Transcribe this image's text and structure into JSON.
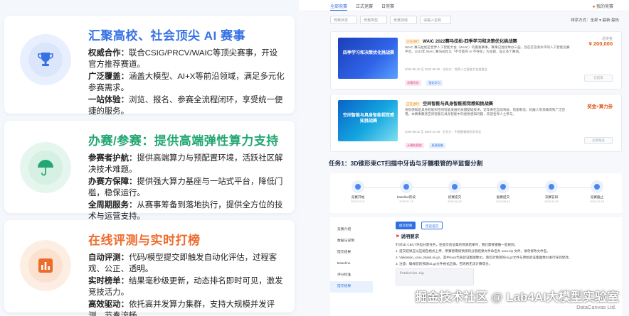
{
  "features": [
    {
      "title": "汇聚高校、社会顶尖 AI 赛事",
      "icon": "trophy-icon",
      "color": "#3672e6",
      "items": [
        {
          "label": "权威合作：",
          "text": "联合CSIG/PRCV/WAIC等顶尖赛事，开设官方推荐赛道。"
        },
        {
          "label": "广泛覆盖：",
          "text": "涵盖大模型、AI+X等前沿领域，满足多元化参赛需求。"
        },
        {
          "label": "一站体验：",
          "text": "浏览、报名、参赛全流程闭环，享受统一便捷的服务。"
        }
      ]
    },
    {
      "title": "办赛/参赛：提供高端弹性算力支持",
      "icon": "umbrella-icon",
      "color": "#23a772",
      "items": [
        {
          "label": "参赛者护航：",
          "text": "提供高端算力与预配置环境，活跃社区解决技术难题。"
        },
        {
          "label": "办赛方保障：",
          "text": "提供强大算力基座与一站式平台，降低门槛，稳保运行。"
        },
        {
          "label": "全周期服务：",
          "text": "从赛事筹备到落地执行，提供全方位的技术与运营支持。"
        }
      ]
    },
    {
      "title": "在线评测与实时打榜",
      "icon": "bar-chart-icon",
      "color": "#ef6b2c",
      "items": [
        {
          "label": "自动评测：",
          "text": "代码/模型提交即触发自动化评估，过程客观、公正、透明。"
        },
        {
          "label": "实时榜单：",
          "text": "结果毫秒级更新，动态排名即时可见，激发竞技活力。"
        },
        {
          "label": "高效驱动：",
          "text": "依托高并发算力集群，支持大规模并发评测，节奏流畅。"
        }
      ]
    }
  ],
  "platform": {
    "tabs": [
      "全部竞赛",
      "正式竞赛",
      "日常赛"
    ],
    "top_right": "我的竞赛",
    "filters": [
      "竞赛状态",
      "竞赛类型",
      "竞赛领域",
      "请输入名称"
    ],
    "sort_label": "排序方式：全部 ▾  最新  最热",
    "competitions": [
      {
        "status_tag": "正在进行",
        "name": "WAIC 2022赛马拉松-四季学习和决策优化挑战赛",
        "desc": "WAIC 赛马拉松是世界人工智能大会（WAIC）的重要赛事，赛事已连续举办三届，旨在打造高水平的人工智能竞赛平台。2022年 WAIC 赛马拉松以「不可能的 AI 不存在」为主题，设立多个赛道。",
        "meta": "2022-06-10 至 2022-08-30 · 主办方：世界人工智能大会组委会",
        "tags": [
          "决策优化",
          "强化学习"
        ],
        "prize_label": "总奖金",
        "prize": "¥ 200,000",
        "button": "已结束",
        "banner_text": "四季学习和决策优化挑战赛"
      },
      {
        "status_tag": "正在进行",
        "name": "空间智能与具身智能视觉感知挑战赛",
        "desc": "视觉感知是具身智能和空间智能发展的关键基础技术，近年来在自动驾驶、智能制造、机器人等领域得到广泛应用。本赛事聚焦空间智能与具身智能中的视觉感知问题，欢迎各界人士参与。",
        "meta": "2025-06-11 至 2025-10-18 · 主办方：中国图象图形学学会",
        "tags": [
          "计算机视觉",
          "具身智能"
        ],
        "prize_label": "奖金+算力券",
        "prize": "奖金+算力券",
        "button": "立即报名",
        "banner_text": "空间智能与具身智能视觉感知挑战赛"
      }
    ],
    "task_title": "任务1：3D锥形束CT扫描中牙齿与牙髓根管的半监督分割",
    "timeline": [
      {
        "label": "竞赛开始",
        "date": "2025-07-01"
      },
      {
        "label": "baseline阶段",
        "date": "2025-07-15"
      },
      {
        "label": "初赛提交",
        "date": "2025-08-20"
      },
      {
        "label": "复赛提交",
        "date": "2025-09-10"
      },
      {
        "label": "决赛答辩",
        "date": "2025-09-25"
      },
      {
        "label": "竞赛截止",
        "date": "2025-10-18"
      }
    ],
    "side_nav": [
      "竞赛介绍",
      "数据与说明",
      "提交结果",
      "Baseline",
      "评分标准",
      "提交结果"
    ],
    "sub_tabs": [
      "提交结果",
      "历史提交"
    ],
    "section_title": "说明要求",
    "paragraphs": [
      "针对3D CBCT牙齿分割任务，在提交验证集的预测结果时，我们需要遵循一些规则。",
      "1. 提交结果应以压缩包格式上传，参赛者需将预测的分割结果文件命名为 xxxx.zip 文件，请勿修改文件名。",
      "2. Validation_xxxx_Mask.nii.gz，其中xxxx代表验证集图像ID，请勿对预测的nii.gz文件与原始验证集图像ID进行任何修改。",
      "3. 注意：确保您的预测nii.gz文件格式正确，否则将无法计算得分。"
    ],
    "code_text": "Prediction.zip"
  },
  "watermark": "掘金技术社区 @ Lab4AI大模型实验室",
  "watermark_sub": "DataCanvas Ltd."
}
